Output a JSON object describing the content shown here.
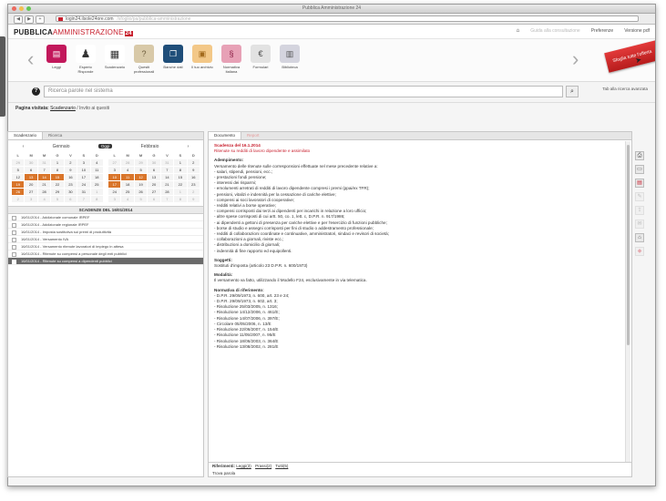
{
  "browser": {
    "window_title": "Pubblica Amministrazione 24",
    "url": "login24.ilsole24ore.com",
    "url_suffix": "/sfoglio/pa/pubblica-amministrazione"
  },
  "header": {
    "logo_bold": "PUBBLICA",
    "logo_thin": "AMMINISTRAZIONE",
    "logo_badge": "24",
    "links": [
      "Guida alla consultazione",
      "Preferenze",
      "Versione pdf"
    ],
    "home_icon": "home-icon"
  },
  "toolbar": {
    "items": [
      {
        "label": "Leggi",
        "color": "#c2185b",
        "icon": "news-icon"
      },
      {
        "label": "Esperto Risponde",
        "color": "#7a7a7a",
        "icon": "person-icon"
      },
      {
        "label": "Scadenzario",
        "color": "#7a7a7a",
        "icon": "calendar-icon"
      },
      {
        "label": "Quesiti professionali",
        "color": "#9c7b4d",
        "icon": "questions-icon"
      },
      {
        "label": "Banche dati",
        "color": "#1f4e79",
        "icon": "database-icon"
      },
      {
        "label": "Il tuo archivio",
        "color": "#e8a23a",
        "icon": "archive-icon"
      },
      {
        "label": "Normativa italiana",
        "color": "#d14d7a",
        "icon": "law-icon"
      },
      {
        "label": "Formulari",
        "color": "#6d6d6d",
        "icon": "forms-icon"
      },
      {
        "label": "Biblioteca",
        "color": "#8a8a9a",
        "icon": "library-icon"
      }
    ],
    "ribbon_label": "Sfoglia tutte l'offerta"
  },
  "search": {
    "placeholder": "Ricerca parole nel sistema",
    "side_link": "Tab alla ricerca avanzata"
  },
  "breadcrumb": {
    "label": "Pagina visitata:",
    "current": "Scadenzario",
    "trail": "/ Invito ai quesiti"
  },
  "calendar": {
    "tabs": [
      "Scadenzario",
      "Ricerca"
    ],
    "prev_month": "Gennaio",
    "today_label": "Oggi",
    "next_month": "Febbraio",
    "weekdays": [
      "L",
      "M",
      "M",
      "G",
      "V",
      "S",
      "D"
    ],
    "month1": [
      "29",
      "30",
      "31",
      "1",
      "2",
      "3",
      "4",
      "5",
      "6",
      "7",
      "8",
      "9",
      "10",
      "11",
      "12",
      "13",
      "14",
      "15",
      "16",
      "17",
      "18",
      "19",
      "20",
      "21",
      "22",
      "23",
      "24",
      "25",
      "26",
      "27",
      "28",
      "29",
      "30",
      "31",
      "1",
      "2",
      "3",
      "4",
      "5",
      "6",
      "7",
      "8"
    ],
    "month1_hl": [
      15,
      16,
      17,
      21,
      28
    ],
    "month2": [
      "27",
      "28",
      "29",
      "30",
      "31",
      "1",
      "2",
      "3",
      "4",
      "5",
      "6",
      "7",
      "8",
      "9",
      "10",
      "11",
      "12",
      "13",
      "14",
      "15",
      "16",
      "17",
      "18",
      "19",
      "20",
      "21",
      "22",
      "23",
      "24",
      "25",
      "26",
      "27",
      "28",
      "1",
      "2",
      "3",
      "4",
      "5",
      "6",
      "7",
      "8",
      "9"
    ],
    "month2_hl": [
      14,
      15,
      16,
      21
    ],
    "schedule_title": "SCADENZE DEL 16/01/2014",
    "rows": [
      "16/01/2014 - Addizionale comunale IRPEF",
      "16/01/2014 - Addizionale regionale IRPEF",
      "16/01/2014 - Imposta sostitutiva sui premi di produttività",
      "16/01/2014 - Versamento IVA",
      "16/01/2014 - Versamento ritenute lavoratori di impiego in attesa",
      "16/01/2014 - Ritenute su compensi a personale degli enti pubblici",
      "16/01/2014 - Ritenute su compensi a dipendenti pubblici"
    ],
    "selected_row": 6
  },
  "document": {
    "tabs": [
      "Documento",
      "Report"
    ],
    "title": "Scadenza del 16.1.2014",
    "subtitle": "Ritenute su redditi di lavoro dipendente e assimilato",
    "sections": [
      {
        "heading": "Adempimento:",
        "lines": [
          "Versamento delle ritenute sulle corresponsioni effettuate nel mese precedente relative a:",
          "- salari, stipendi, pensioni, ecc.;",
          "- prestazioni fondi pensione;",
          "- interessi dei risparmi;",
          "- emolumenti arretrati di redditi di lavoro dipendente compresi i premi (ppai/ex TFR);",
          "- pensioni, vitalizi e indennità per la cessazione di cariche elettive;",
          "- compensi ai soci lavoratori di cooperative;",
          "- redditi relativi a borse operative;",
          "- compensi corrisposti dai terzi ai dipendenti per incarichi in relazione a loro ufficio;",
          "- altre spese corrisposti di cui artt. 50, co. 1, lett. c, D.P.R. n. 917/1986;",
          "- ai dipendenti a gettoni di presenza per cariche elettive e per l'esercizio di funzioni pubbliche;",
          "- borse di studio e assegni corrisposti per fini di studio o addestramento professionale;",
          "- redditi di collaborazioni coordinate e continuative, amministratori, sindaci e revisori di società;",
          "- collaborazioni a giornali, riviste ecc.;",
          "- distribuzioni a domicilio di giornali;",
          "- indennità di fine rapporto ed equipollenti."
        ]
      },
      {
        "heading": "Soggetti:",
        "lines": [
          "Sostituti d'imposta (articolo 23 D.P.R. n. 600/1973)"
        ]
      },
      {
        "heading": "Modalità:",
        "lines": [
          "Il versamento va fatto, utilizzando il Modello F24, esclusivamente in via telematica."
        ]
      },
      {
        "heading": "Normativa di riferimento:",
        "lines": [
          "- D.P.R. 29/09/1973, n. 600, art. 23 e 24;",
          "- D.P.R. 29/09/1973, n. 602, art. 3;",
          "- Risoluzione 25/03/2005, n. 1316;",
          "- Risoluzione 14/12/2006, n. 461/E;",
          "- Risoluzione 14/07/2006, n. 397/E;",
          "- Circolare 05/05/2006, n. 13/E",
          "- Risoluzione 22/06/2007, n. 154/E",
          "- Risoluzione 11/05/2007, n. 95/E",
          "- Risoluzione 18/06/2003, n. 364/E",
          "- Risoluzione 13/08/2002, n. 281/E"
        ]
      }
    ],
    "footer_label": "Riferimenti:",
    "footer_links": [
      "Leggi(3)",
      "Prassi(2)",
      "Tutti(5)"
    ],
    "footer_note": "Trova parola"
  },
  "side_tools": [
    "print-icon",
    "save-icon",
    "pdf-icon",
    "note-icon",
    "share-icon",
    "mail-icon",
    "bookmark-icon",
    "tag-icon"
  ]
}
